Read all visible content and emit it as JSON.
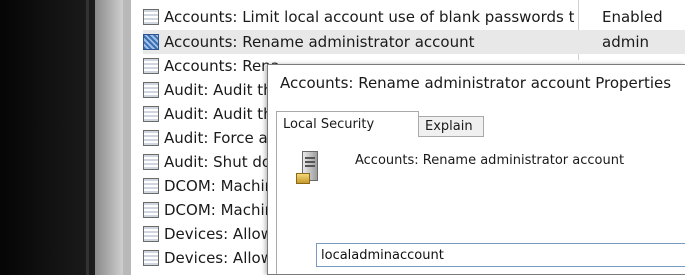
{
  "policy_list": {
    "rows": [
      {
        "name": "Accounts: Limit local account use of blank passwords to co...",
        "value": "Enabled",
        "selected": false
      },
      {
        "name": "Accounts: Rename administrator account",
        "value": "admin",
        "selected": true
      },
      {
        "name": "Accounts: Rena",
        "value": "",
        "selected": false
      },
      {
        "name": "Audit: Audit the",
        "value": "",
        "selected": false
      },
      {
        "name": "Audit: Audit the",
        "value": "",
        "selected": false
      },
      {
        "name": "Audit: Force aud",
        "value": "",
        "selected": false
      },
      {
        "name": "Audit: Shut dow",
        "value": "",
        "selected": false
      },
      {
        "name": "DCOM: Machin",
        "value": "",
        "selected": false
      },
      {
        "name": "DCOM: Machin",
        "value": "",
        "selected": false
      },
      {
        "name": "Devices: Allow u",
        "value": "",
        "selected": false
      },
      {
        "name": "Devices: Allowe",
        "value": "",
        "selected": false
      }
    ]
  },
  "dialog": {
    "title": "Accounts: Rename administrator account Properties",
    "tabs": [
      "Local Security Setting",
      "Explain"
    ],
    "policy_name": "Accounts: Rename administrator account",
    "input_value": "localadminaccount"
  }
}
